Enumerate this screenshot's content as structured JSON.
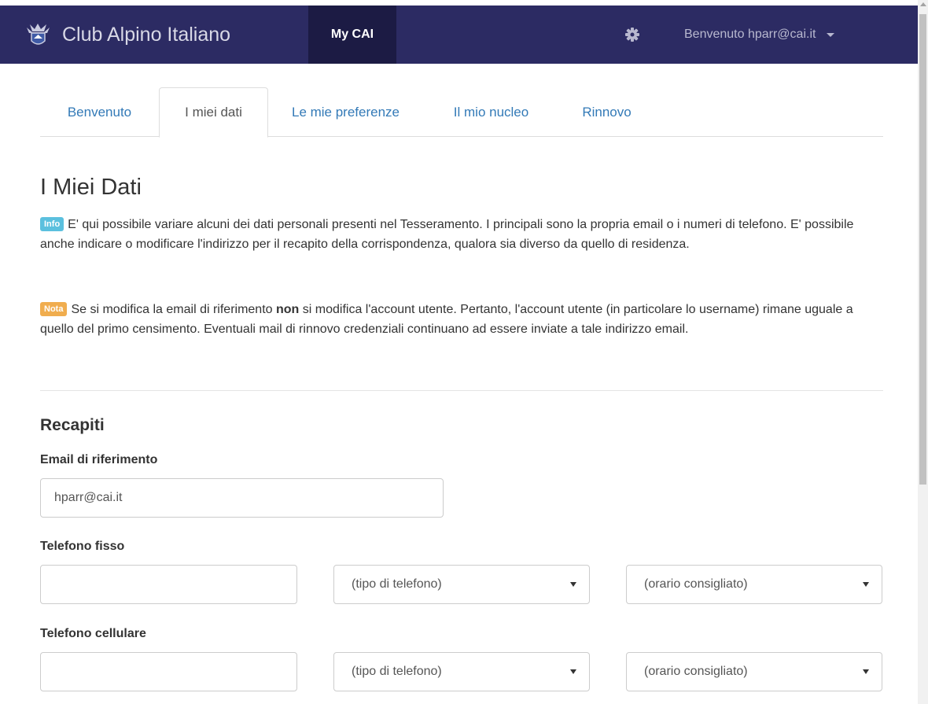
{
  "navbar": {
    "brand": "Club Alpino Italiano",
    "my_cai": "My CAI",
    "user": "Benvenuto hparr@cai.it"
  },
  "tabs": [
    {
      "label": "Benvenuto"
    },
    {
      "label": "I miei dati",
      "active": true
    },
    {
      "label": "Le mie preferenze"
    },
    {
      "label": "Il mio nucleo"
    },
    {
      "label": "Rinnovo"
    }
  ],
  "page": {
    "title": "I Miei Dati",
    "info_tag": "Info",
    "info_text": "E' qui possibile variare alcuni dei dati personali presenti nel Tesseramento. I principali sono la propria email o i numeri di telefono. E' possibile anche indicare o modificare l'indirizzo per il recapito della corrispondenza, qualora sia diverso da quello di residenza.",
    "note_tag": "Nota",
    "note_text_1": "Se si modifica la email di riferimento",
    "note_bold": "non",
    "note_text_2": "si modifica l'account utente. Pertanto, l'account utente (in particolare lo username) rimane uguale a quello del primo censimento. Eventuali mail di rinnovo credenziali continuano ad essere inviate a tale indirizzo email."
  },
  "recapiti": {
    "title": "Recapiti",
    "email_label": "Email di riferimento",
    "email_value": "hparr@cai.it",
    "fisso_label": "Telefono fisso",
    "fisso_value": "",
    "fisso_tipo": "(tipo di telefono)",
    "fisso_orario": "(orario consigliato)",
    "cell_label": "Telefono cellulare",
    "cell_value": "",
    "cell_tipo": "(tipo di telefono)",
    "cell_orario": "(orario consigliato)"
  },
  "colors": {
    "navbar": "#2c2b63",
    "navbar_active": "#1c1b44",
    "link": "#337ab7",
    "info": "#5bc0de",
    "warning": "#f0ad4e"
  },
  "icons": [
    "cai-logo-icon",
    "gear-icon",
    "caret-down-icon"
  ]
}
